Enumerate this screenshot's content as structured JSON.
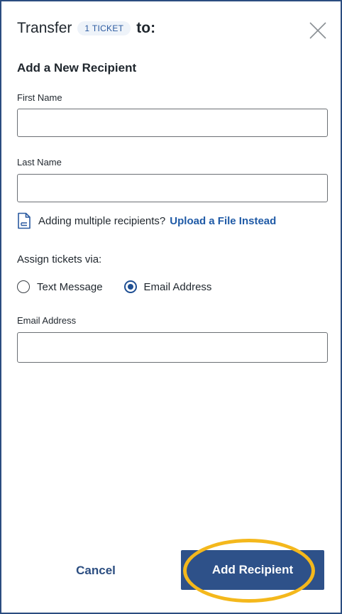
{
  "dialog": {
    "title_prefix": "Transfer",
    "ticket_badge": "1 TICKET",
    "title_suffix": "to:",
    "close_icon": "close-icon"
  },
  "form": {
    "section_title": "Add a New Recipient",
    "first_name_label": "First Name",
    "first_name_value": "",
    "last_name_label": "Last Name",
    "last_name_value": "",
    "upload_prompt": "Adding multiple recipients?",
    "upload_link": "Upload a File Instead",
    "assign_label": "Assign tickets via:",
    "assign_options": [
      {
        "label": "Text Message",
        "selected": false
      },
      {
        "label": "Email Address",
        "selected": true
      }
    ],
    "email_label": "Email Address",
    "email_value": ""
  },
  "footer": {
    "cancel_label": "Cancel",
    "add_label": "Add Recipient"
  },
  "colors": {
    "primary": "#2e5189",
    "link": "#1f5aa6",
    "highlight": "#f4b81c"
  }
}
